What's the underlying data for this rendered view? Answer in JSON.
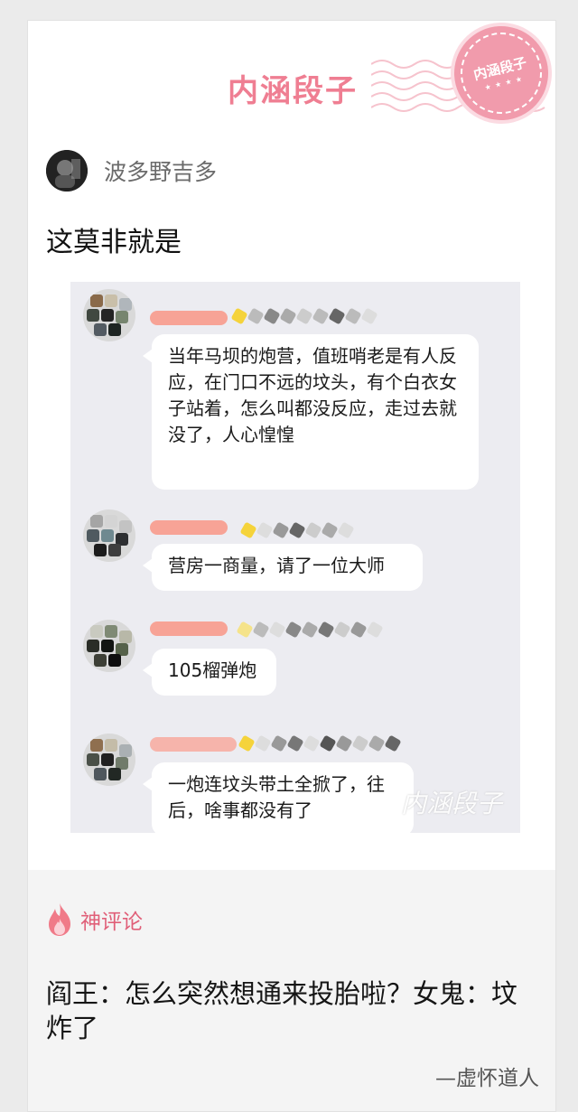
{
  "brand": {
    "logo_text": "内涵段子",
    "stamp_text": "内涵段子",
    "stamp_stars": "★ ★ ★ ★"
  },
  "post": {
    "author_name": "波多野吉多",
    "text": "这莫非就是",
    "screenshot": {
      "messages": [
        "当年马坝的炮营，值班哨老是有人反应，在门口不远的坟头，有个白衣女子站着，怎么叫都没反应，走过去就没了，人心惶惶",
        "营房一商量，请了一位大师",
        "105榴弹炮",
        "一炮连坟头带土全掀了，往后，啥事都没有了"
      ],
      "watermark": "内涵段子"
    }
  },
  "hot_comment": {
    "label": "神评论",
    "text": "阎王：怎么突然想通来投胎啦？女鬼：坟炸了",
    "author": "—虚怀道人"
  },
  "colors": {
    "brand_pink": "#ef7e92",
    "comment_label": "#e05f78",
    "background": "#ebebeb"
  },
  "icons": [
    "stamp-icon",
    "flame-icon"
  ]
}
